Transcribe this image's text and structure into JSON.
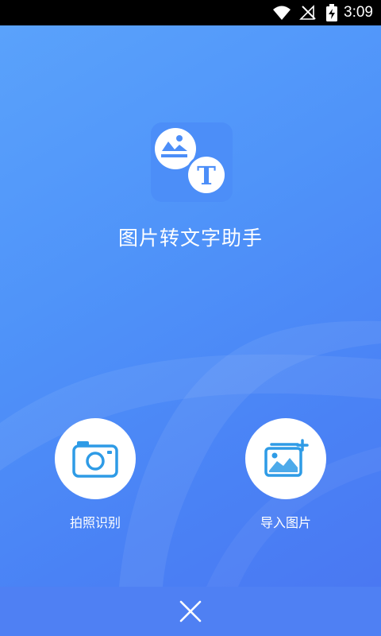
{
  "status_bar": {
    "time": "3:09",
    "icons": [
      "wifi-icon",
      "no-signal-icon",
      "battery-charging-icon"
    ]
  },
  "app": {
    "title": "图片转文字助手",
    "logo_icon": "image-to-text-logo-icon",
    "logo_letter": "T"
  },
  "actions": [
    {
      "label": "拍照识别",
      "icon": "camera-icon"
    },
    {
      "label": "导入图片",
      "icon": "image-import-icon"
    }
  ],
  "bottom_bar": {
    "close_icon": "close-icon"
  },
  "colors": {
    "background_top": "#5aa2fb",
    "background_bottom": "#4a78f2",
    "accent": "#2e9be6",
    "white": "#ffffff",
    "status_bar": "#000000"
  }
}
